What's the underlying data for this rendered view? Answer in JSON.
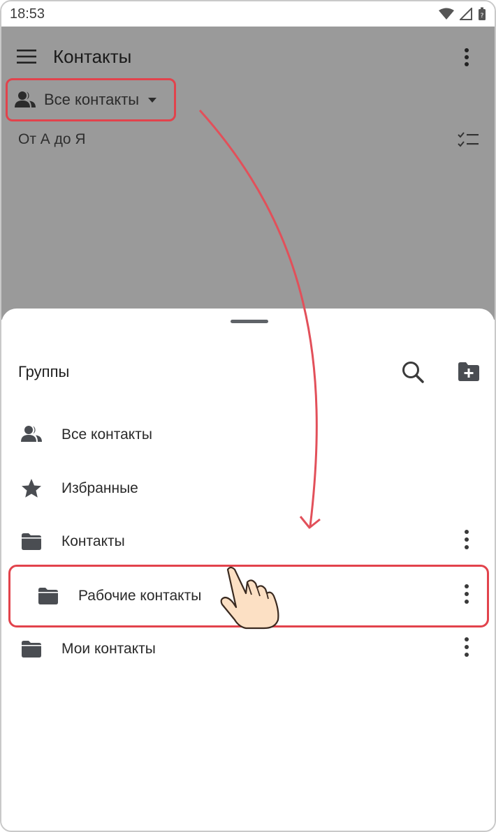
{
  "status_bar": {
    "time": "18:53"
  },
  "toolbar": {
    "title": "Контакты"
  },
  "filter": {
    "label": "Все контакты"
  },
  "sort": {
    "label": "От А до Я"
  },
  "sheet": {
    "title": "Группы",
    "items": [
      {
        "label": "Все контакты",
        "icon": "people-icon"
      },
      {
        "label": "Избранные",
        "icon": "star-icon"
      },
      {
        "label": "Контакты",
        "icon": "folder-icon"
      },
      {
        "label": "Рабочие контакты",
        "icon": "folder-icon"
      },
      {
        "label": "Мои контакты",
        "icon": "folder-icon"
      }
    ]
  },
  "colors": {
    "highlight": "#e2434c",
    "dim_background": "#9a9a9a",
    "icon_dark": "#4a4d52"
  }
}
